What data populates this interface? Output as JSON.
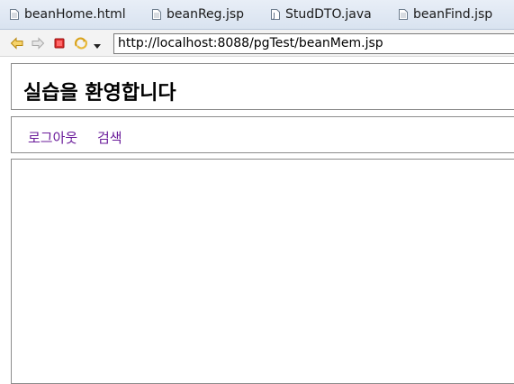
{
  "tabs": [
    {
      "label": "beanHome.html",
      "icon": "html-file-icon"
    },
    {
      "label": "beanReg.jsp",
      "icon": "jsp-file-icon"
    },
    {
      "label": "StudDTO.java",
      "icon": "java-file-icon"
    },
    {
      "label": "beanFind.jsp",
      "icon": "jsp-file-icon"
    }
  ],
  "toolbar": {
    "url": "http://localhost:8088/pgTest/beanMem.jsp"
  },
  "page": {
    "title": "실습을 환영합니다",
    "nav": {
      "logout": "로그아웃",
      "search": "검색"
    }
  },
  "colors": {
    "link": "#6a1b9a",
    "tabbar": "#dfe7f2",
    "frame_border": "#8c8c8c"
  }
}
